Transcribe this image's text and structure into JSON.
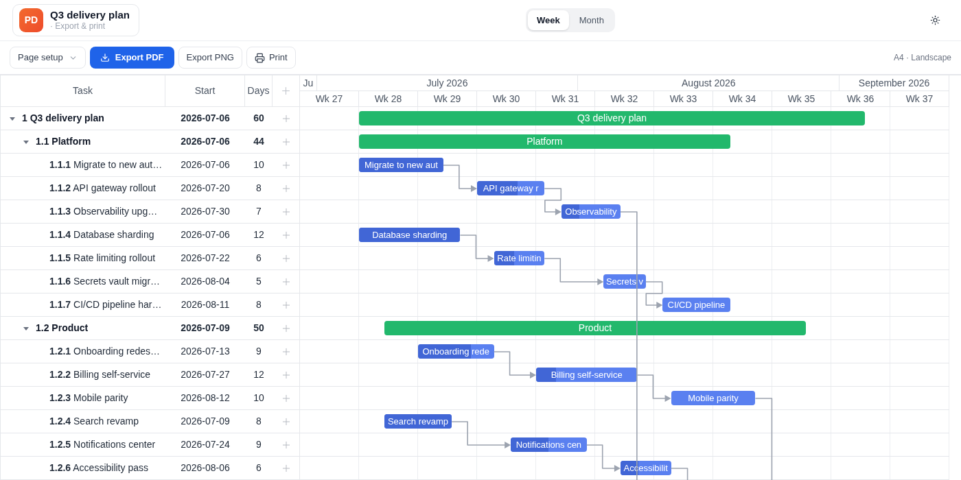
{
  "app": {
    "logo": "PD",
    "title": "Q3 delivery plan",
    "subtitle": "· Export & print"
  },
  "view_switch": [
    {
      "label": "Week",
      "selected": true
    },
    {
      "label": "Month",
      "selected": false
    }
  ],
  "toolbar": {
    "page_setup": "Page setup",
    "export_pdf": "Export PDF",
    "export_png": "Export PNG",
    "print": "Print",
    "paper": "A4 · Landscape"
  },
  "columns": [
    "Task",
    "Start",
    "Days"
  ],
  "months": [
    "Ju",
    "July 2026",
    "August 2026",
    "September 2026"
  ],
  "weeks": [
    "Wk 27",
    "Wk 28",
    "Wk 29",
    "Wk 30",
    "Wk 31",
    "Wk 32",
    "Wk 33",
    "Wk 34",
    "Wk 35",
    "Wk 36",
    "Wk 37"
  ],
  "tasks": [
    {
      "code": "1",
      "name": "Q3 delivery plan",
      "start": "2026-07-06",
      "days": "60",
      "kind": "summary",
      "expanded": true,
      "bar_label": "Q3 delivery plan",
      "children": [
        {
          "code": "1.1",
          "name": "Platform",
          "start": "2026-07-06",
          "days": "44",
          "kind": "summary",
          "expanded": true,
          "bar_label": "Platform",
          "children": [
            {
              "code": "1.1.1",
              "name": "Migrate to new aut…",
              "start": "2026-07-06",
              "days": "10",
              "kind": "task",
              "level": 1,
              "bar_label": "Migrate to new aut",
              "linked": false,
              "link_down": false
            },
            {
              "code": "1.1.2",
              "name": "API gateway rollout",
              "start": "2026-07-20",
              "days": "8",
              "kind": "task",
              "level": 0.6,
              "bar_label": "API gateway r",
              "linked": true,
              "link_down": false
            },
            {
              "code": "1.1.3",
              "name": "Observability upg…",
              "start": "2026-07-30",
              "days": "7",
              "kind": "task",
              "level": 0.3,
              "bar_label": "Observability",
              "linked": true,
              "link_down": true
            },
            {
              "code": "1.1.4",
              "name": "Database sharding",
              "start": "2026-07-06",
              "days": "12",
              "kind": "task",
              "level": 1,
              "bar_label": "Database sharding",
              "linked": false,
              "link_down": false
            },
            {
              "code": "1.1.5",
              "name": "Rate limiting rollout",
              "start": "2026-07-22",
              "days": "6",
              "kind": "task",
              "level": 0.4,
              "bar_label": "Rate limitin",
              "linked": true,
              "link_down": false
            },
            {
              "code": "1.1.6",
              "name": "Secrets vault migr…",
              "start": "2026-08-04",
              "days": "5",
              "kind": "task",
              "level": 0,
              "bar_label": "Secrets v",
              "linked": true,
              "link_down": false
            },
            {
              "code": "1.1.7",
              "name": "CI/CD pipeline har…",
              "start": "2026-08-11",
              "days": "8",
              "kind": "task",
              "level": 0,
              "bar_label": "CI/CD pipeline",
              "linked": true,
              "link_down": false
            }
          ]
        },
        {
          "code": "1.2",
          "name": "Product",
          "start": "2026-07-09",
          "days": "50",
          "kind": "summary",
          "expanded": true,
          "bar_label": "Product",
          "children": [
            {
              "code": "1.2.1",
              "name": "Onboarding redes…",
              "start": "2026-07-13",
              "days": "9",
              "kind": "task",
              "level": 0.7,
              "bar_label": "Onboarding rede",
              "linked": false,
              "link_down": false
            },
            {
              "code": "1.2.2",
              "name": "Billing self-service",
              "start": "2026-07-27",
              "days": "12",
              "kind": "task",
              "level": 0.2,
              "bar_label": "Billing self-service",
              "linked": true,
              "link_down": false
            },
            {
              "code": "1.2.3",
              "name": "Mobile parity",
              "start": "2026-08-12",
              "days": "10",
              "kind": "task",
              "level": 0,
              "bar_label": "Mobile parity",
              "linked": true,
              "link_down": true
            },
            {
              "code": "1.2.4",
              "name": "Search revamp",
              "start": "2026-07-09",
              "days": "8",
              "kind": "task",
              "level": 1,
              "bar_label": "Search revamp",
              "linked": false,
              "link_down": false
            },
            {
              "code": "1.2.5",
              "name": "Notifications center",
              "start": "2026-07-24",
              "days": "9",
              "kind": "task",
              "level": 0.5,
              "bar_label": "Notifications cen",
              "linked": true,
              "link_down": false
            },
            {
              "code": "1.2.6",
              "name": "Accessibility pass",
              "start": "2026-08-06",
              "days": "6",
              "kind": "task",
              "level": 0.35,
              "bar_label": "Accessibilit",
              "linked": true,
              "link_down": true
            }
          ]
        }
      ]
    }
  ]
}
